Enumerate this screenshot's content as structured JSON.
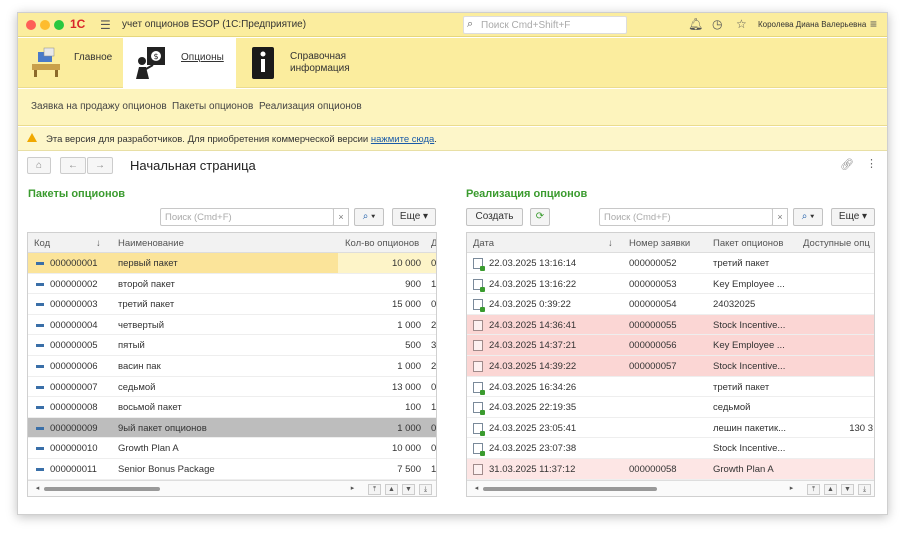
{
  "window": {
    "logo": "1С",
    "title": "учет опционов ESOP  (1С:Предприятие)",
    "search_placeholder": "Поиск Cmd+Shift+F",
    "user": "Королева Диана Валерьевна"
  },
  "sections": [
    {
      "label": "Главное"
    },
    {
      "label": "Опционы"
    },
    {
      "label": "Справочная информация"
    }
  ],
  "subnav": [
    "Заявка на продажу опционов",
    "Пакеты опционов",
    "Реализация опционов"
  ],
  "notice": {
    "text": "Эта версия для разработчиков. Для приобретения коммерческой версии ",
    "link": "нажмите сюда",
    "tail": "."
  },
  "page": {
    "title": "Начальная страница"
  },
  "left_panel": {
    "title": "Пакеты опционов",
    "search_placeholder": "Поиск (Cmd+F)",
    "more_label": "Еще",
    "columns": [
      "Код",
      "Наименование",
      "Кол-во опционов",
      "Д"
    ],
    "rows": [
      {
        "code": "000000001",
        "name": "первый пакет",
        "qty": "10 000",
        "d": "0",
        "state": "current"
      },
      {
        "code": "000000002",
        "name": "второй пакет",
        "qty": "900",
        "d": "1",
        "state": ""
      },
      {
        "code": "000000003",
        "name": "третий пакет",
        "qty": "15 000",
        "d": "0",
        "state": ""
      },
      {
        "code": "000000004",
        "name": "четвертый",
        "qty": "1 000",
        "d": "2",
        "state": ""
      },
      {
        "code": "000000005",
        "name": "пятый",
        "qty": "500",
        "d": "3",
        "state": ""
      },
      {
        "code": "000000006",
        "name": "васин пак",
        "qty": "1 000",
        "d": "2",
        "state": ""
      },
      {
        "code": "000000007",
        "name": "седьмой",
        "qty": "13 000",
        "d": "0",
        "state": ""
      },
      {
        "code": "000000008",
        "name": "восьмой пакет",
        "qty": "100",
        "d": "1",
        "state": ""
      },
      {
        "code": "000000009",
        "name": "9ый пакет опционов",
        "qty": "1 000",
        "d": "0",
        "state": "sel"
      },
      {
        "code": "000000010",
        "name": "Growth Plan A",
        "qty": "10 000",
        "d": "0",
        "state": ""
      },
      {
        "code": "000000011",
        "name": "Senior Bonus Package",
        "qty": "7 500",
        "d": "1",
        "state": ""
      }
    ]
  },
  "right_panel": {
    "title": "Реализация опционов",
    "create_label": "Создать",
    "search_placeholder": "Поиск (Cmd+F)",
    "more_label": "Еще",
    "columns": [
      "Дата",
      "Номер заявки",
      "Пакет опционов",
      "Доступные опц"
    ],
    "rows": [
      {
        "date": "22.03.2025 13:16:14",
        "num": "000000052",
        "pkg": "третий пакет",
        "avail": "",
        "state": "",
        "icon": "g"
      },
      {
        "date": "24.03.2025 13:16:22",
        "num": "000000053",
        "pkg": "Key Employee ...",
        "avail": "",
        "state": "",
        "icon": "g"
      },
      {
        "date": "24.03.2025 0:39:22",
        "num": "000000054",
        "pkg": "24032025",
        "avail": "",
        "state": "",
        "icon": "g"
      },
      {
        "date": "24.03.2025 14:36:41",
        "num": "000000055",
        "pkg": "Stock Incentive...",
        "avail": "",
        "state": "red",
        "icon": "r"
      },
      {
        "date": "24.03.2025 14:37:21",
        "num": "000000056",
        "pkg": "Key Employee ...",
        "avail": "",
        "state": "red",
        "icon": "r"
      },
      {
        "date": "24.03.2025 14:39:22",
        "num": "000000057",
        "pkg": "Stock Incentive...",
        "avail": "",
        "state": "red",
        "icon": "r"
      },
      {
        "date": "24.03.2025 16:34:26",
        "num": "",
        "pkg": "третий пакет",
        "avail": "",
        "state": "",
        "icon": "g"
      },
      {
        "date": "24.03.2025 22:19:35",
        "num": "",
        "pkg": "седьмой",
        "avail": "",
        "state": "",
        "icon": "g"
      },
      {
        "date": "24.03.2025 23:05:41",
        "num": "",
        "pkg": "лешин пакетик...",
        "avail": "130 3",
        "state": "",
        "icon": "g"
      },
      {
        "date": "24.03.2025 23:07:38",
        "num": "",
        "pkg": "Stock Incentive...",
        "avail": "",
        "state": "",
        "icon": "g"
      },
      {
        "date": "31.03.2025 11:37:12",
        "num": "000000058",
        "pkg": "Growth Plan A",
        "avail": "",
        "state": "red2",
        "icon": "r"
      }
    ]
  }
}
